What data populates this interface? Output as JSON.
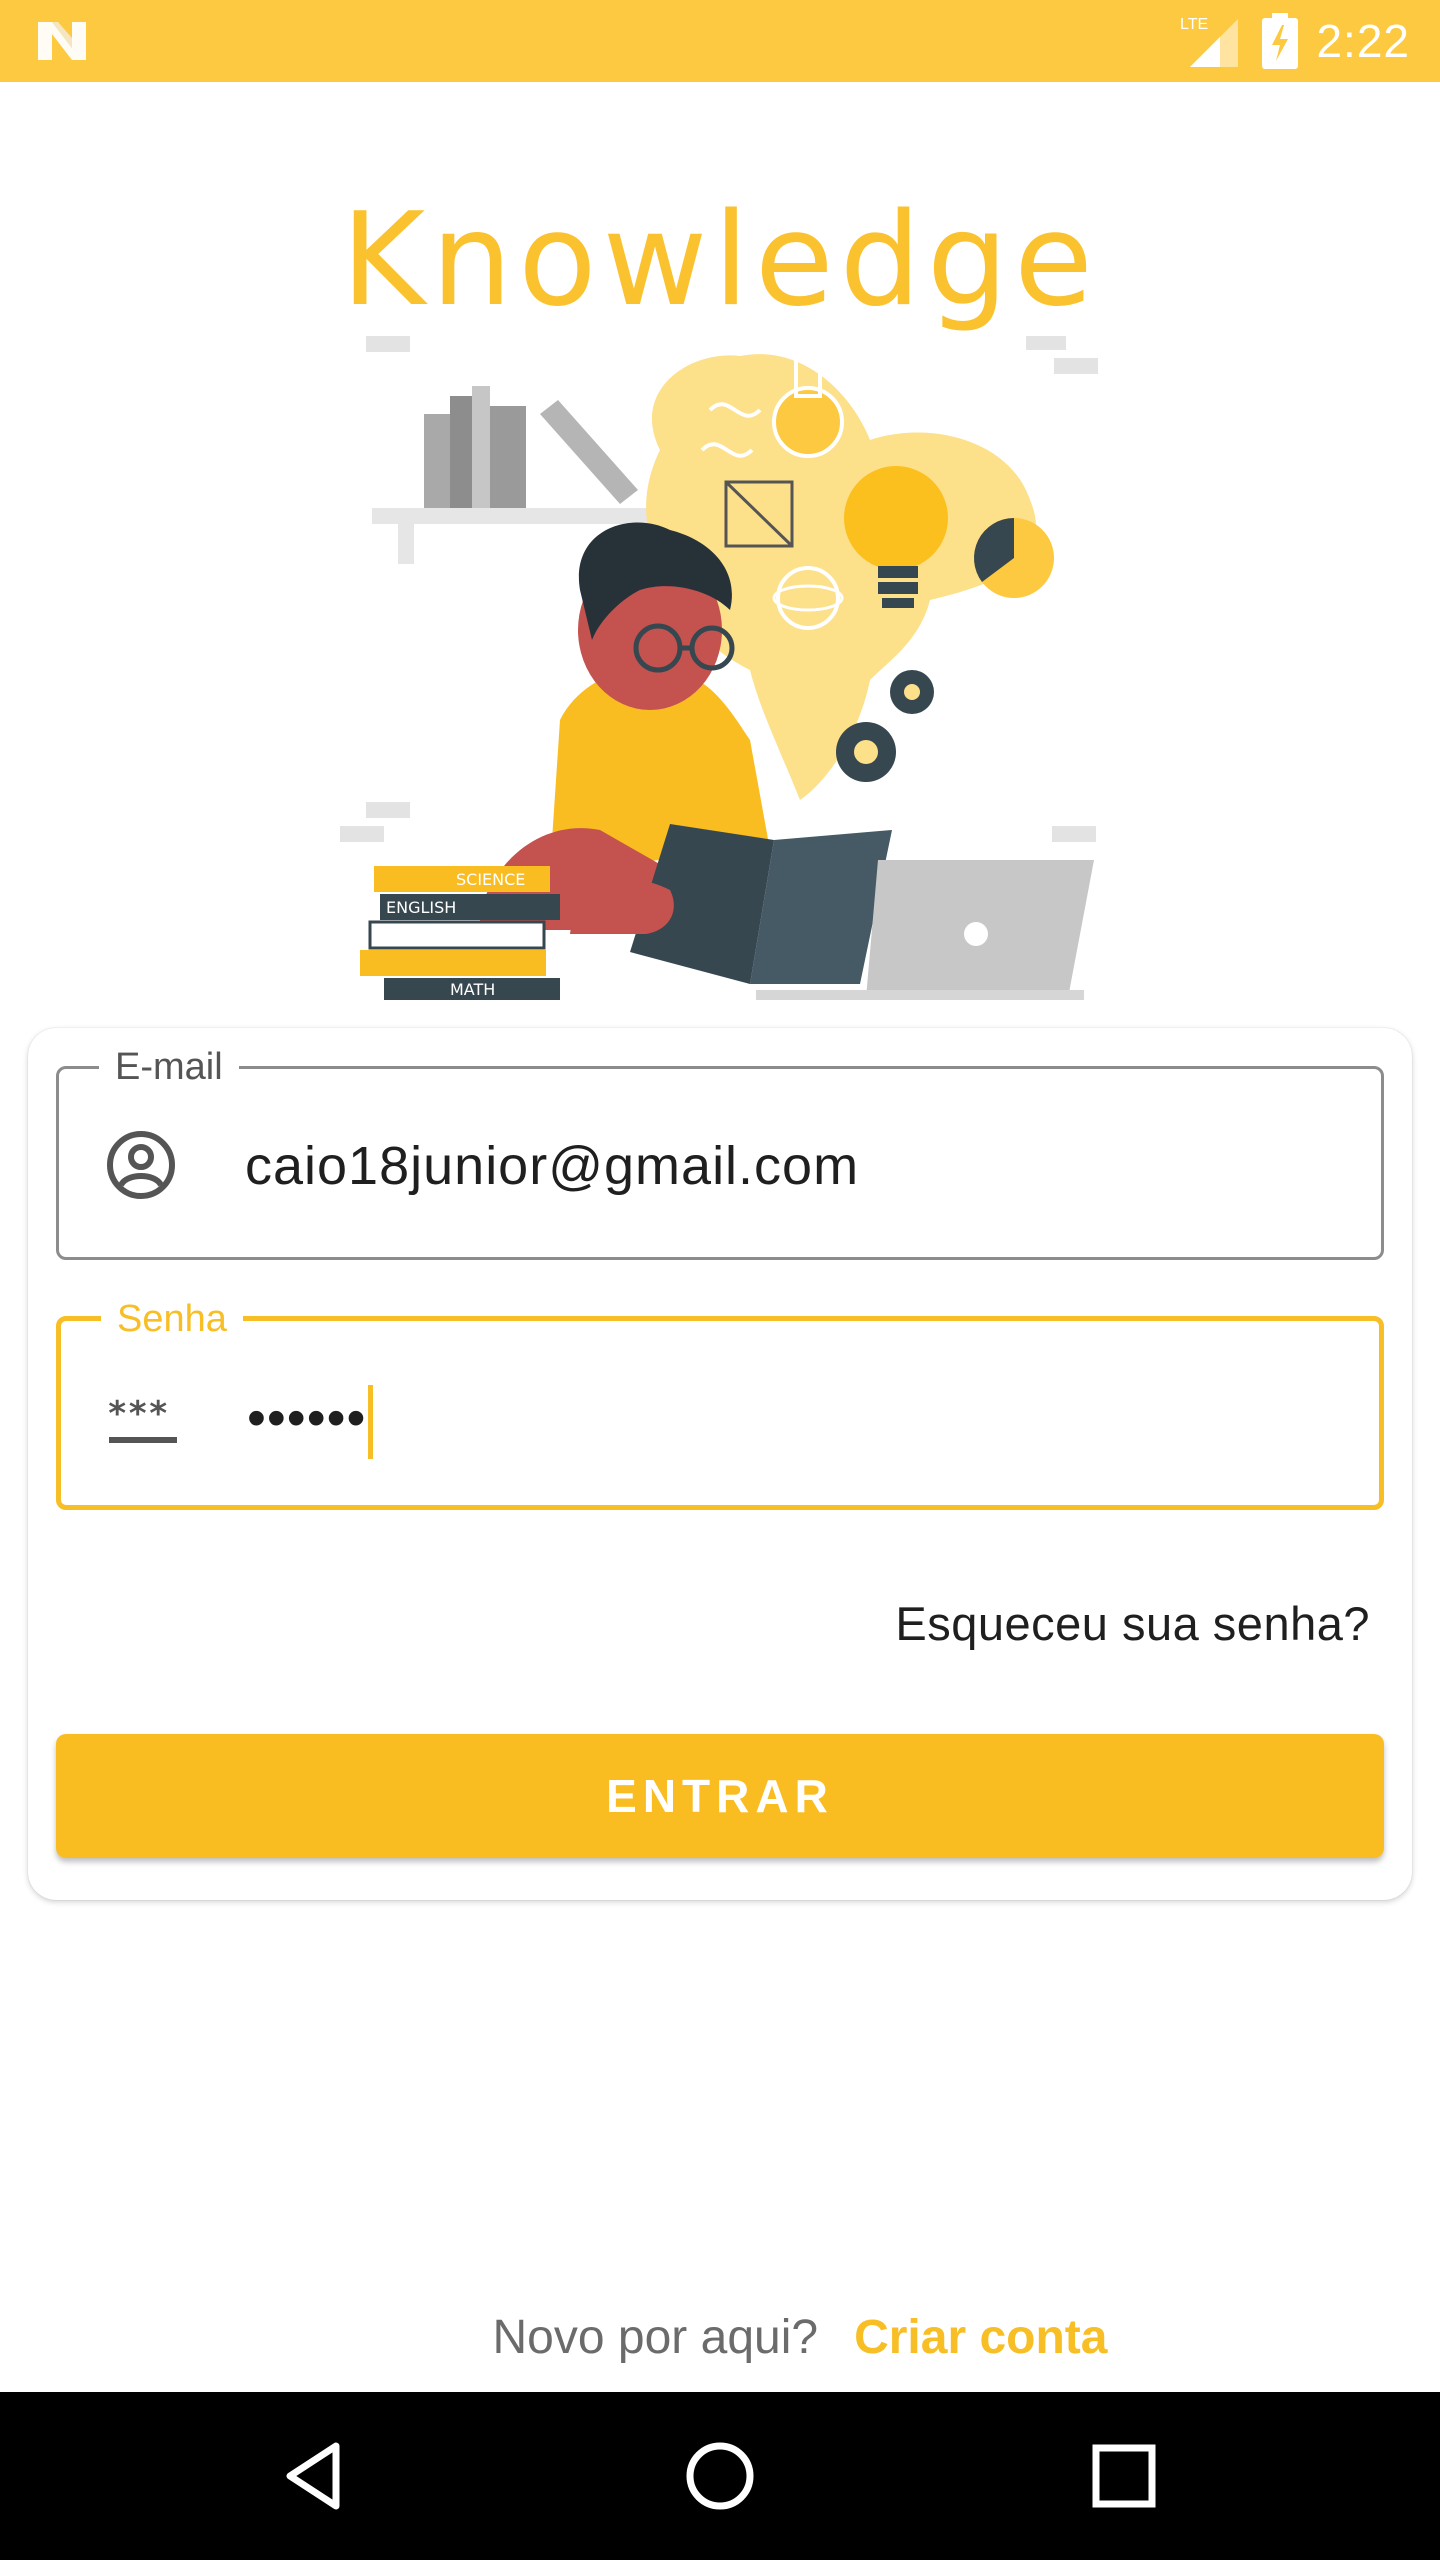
{
  "status_bar": {
    "time": "2:22",
    "network": "LTE",
    "icons": [
      "n-logo-icon",
      "lte-signal-icon",
      "battery-charging-icon"
    ]
  },
  "app": {
    "title": "Knowledge",
    "illustration": "person-reading-books-illustration"
  },
  "login_form": {
    "email": {
      "label": "E-mail",
      "value": "caio18junior@gmail.com",
      "icon": "account-circle-icon"
    },
    "password": {
      "label": "Senha",
      "value": "••••••",
      "icon": "password-icon"
    },
    "forgot_password": "Esqueceu sua senha?",
    "submit_label": "ENTRAR"
  },
  "footer": {
    "prompt": "Novo por aqui?",
    "create_account": "Criar conta"
  },
  "colors": {
    "accent": "#f8be26",
    "status_bar": "#fcc940",
    "title": "#fbc22f"
  },
  "nav_bar": {
    "buttons": [
      "back-icon",
      "home-icon",
      "recents-icon"
    ]
  }
}
